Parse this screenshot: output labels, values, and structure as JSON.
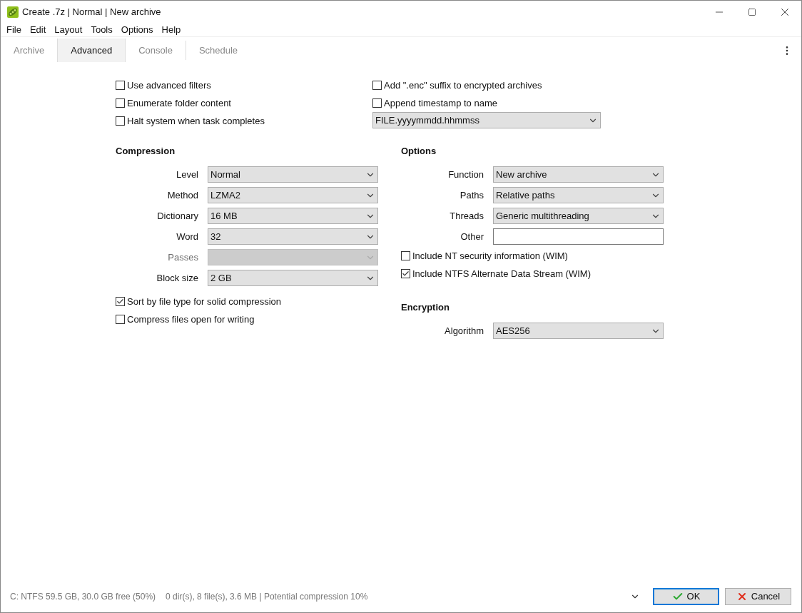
{
  "window": {
    "title": "Create .7z | Normal | New archive"
  },
  "menu": [
    "File",
    "Edit",
    "Layout",
    "Tools",
    "Options",
    "Help"
  ],
  "tabs": [
    {
      "label": "Archive",
      "selected": false
    },
    {
      "label": "Advanced",
      "selected": true
    },
    {
      "label": "Console",
      "selected": false
    },
    {
      "label": "Schedule",
      "selected": false
    }
  ],
  "general": {
    "left_checks": [
      {
        "label": "Use advanced filters",
        "checked": false
      },
      {
        "label": "Enumerate folder content",
        "checked": false
      },
      {
        "label": "Halt system when task completes",
        "checked": false
      }
    ],
    "right_checks": [
      {
        "label": "Add \".enc\" suffix to encrypted archives",
        "checked": false
      },
      {
        "label": "Append timestamp to name",
        "checked": false
      }
    ],
    "timestamp_format": "FILE.yyyymmdd.hhmmss"
  },
  "compression": {
    "title": "Compression",
    "fields": [
      {
        "label": "Level",
        "value": "Normal",
        "disabled": false
      },
      {
        "label": "Method",
        "value": "LZMA2",
        "disabled": false
      },
      {
        "label": "Dictionary",
        "value": "16 MB",
        "disabled": false
      },
      {
        "label": "Word",
        "value": "32",
        "disabled": false
      },
      {
        "label": "Passes",
        "disabled": true
      },
      {
        "label": "Block size",
        "value": "2 GB",
        "disabled": false
      }
    ],
    "checks": [
      {
        "label": "Sort by file type for solid compression",
        "checked": true
      },
      {
        "label": "Compress files open for writing",
        "checked": false
      }
    ]
  },
  "options": {
    "title": "Options",
    "fields": [
      {
        "label": "Function",
        "value": "New archive",
        "kind": "select"
      },
      {
        "label": "Paths",
        "value": "Relative paths",
        "kind": "select"
      },
      {
        "label": "Threads",
        "value": "Generic multithreading",
        "kind": "select"
      },
      {
        "label": "Other",
        "kind": "text"
      }
    ],
    "checks": [
      {
        "label": "Include NT security information (WIM)",
        "checked": false
      },
      {
        "label": "Include NTFS Alternate Data Stream (WIM)",
        "checked": true
      }
    ]
  },
  "encryption": {
    "title": "Encryption",
    "fields": [
      {
        "label": "Algorithm",
        "value": "AES256"
      }
    ]
  },
  "status_bar": {
    "drive": "C: NTFS 59.5 GB, 30.0 GB free (50%)",
    "summary": "0 dir(s), 8 file(s), 3.6 MB | Potential compression 10%"
  },
  "buttons": [
    {
      "label": "OK",
      "kind": "ok",
      "default": true
    },
    {
      "label": "Cancel",
      "kind": "cancel",
      "default": false
    }
  ]
}
